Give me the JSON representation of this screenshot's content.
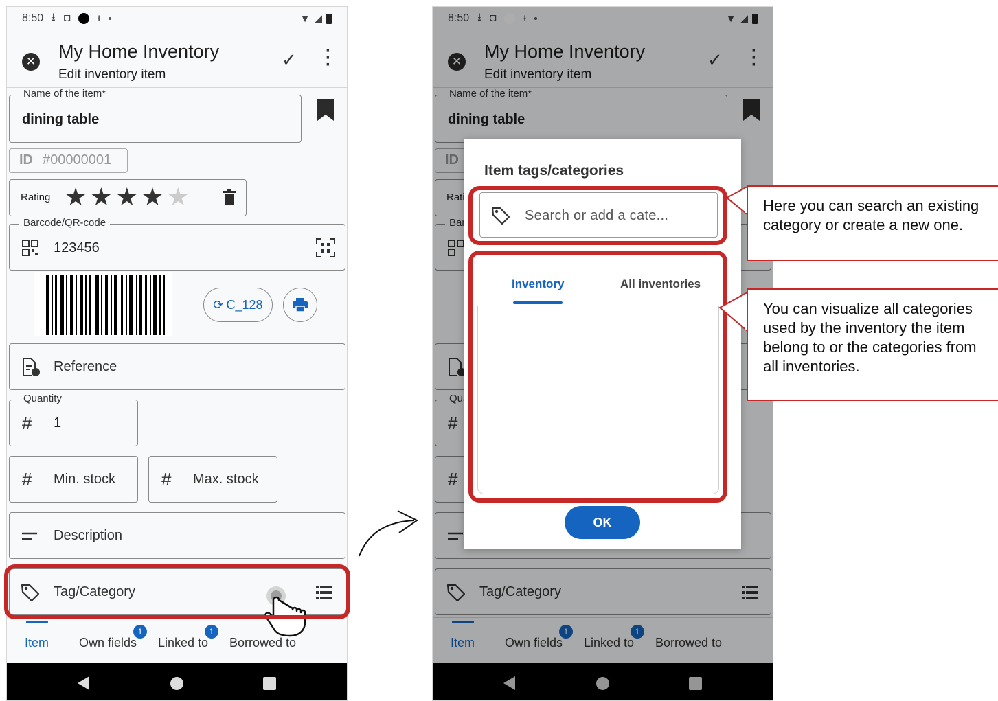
{
  "status_bar": {
    "time": "8:50"
  },
  "app_bar": {
    "title": "My Home Inventory",
    "subtitle": "Edit inventory item",
    "close_icon": "close-circle-icon",
    "confirm_icon": "check-icon",
    "more_icon": "more-vert-icon"
  },
  "form": {
    "name_label": "Name of the item*",
    "name_value": "dining table",
    "id_prefix": "ID",
    "id_value": "#00000001",
    "rating_label": "Rating",
    "rating_value": 4,
    "rating_max": 5,
    "barcode_label": "Barcode/QR-code",
    "barcode_value": "123456",
    "barcode_type_button": "C_128",
    "reference_placeholder": "Reference",
    "quantity_label": "Quantity",
    "quantity_value": "1",
    "min_stock_placeholder": "Min. stock",
    "max_stock_placeholder": "Max. stock",
    "description_placeholder": "Description",
    "tag_placeholder": "Tag/Category"
  },
  "bottom_nav": {
    "items": [
      {
        "label": "Item",
        "active": true
      },
      {
        "label": "Own fields",
        "badge": "1"
      },
      {
        "label": "Linked to",
        "badge": "1"
      },
      {
        "label": "Borrowed to"
      }
    ]
  },
  "dialog": {
    "title": "Item tags/categories",
    "search_placeholder": "Search or add a cate...",
    "tabs": [
      {
        "label": "Inventory",
        "active": true
      },
      {
        "label": "All inventories"
      }
    ],
    "ok_label": "OK"
  },
  "callouts": {
    "search": "Here you can search an existing category or create a new one.",
    "tabs": "You can visualize all categories used by the inventory the item belong to or the categories from all inventories."
  },
  "colors": {
    "accent": "#1565c0",
    "highlight": "#c62828",
    "scrim": "#000000"
  }
}
